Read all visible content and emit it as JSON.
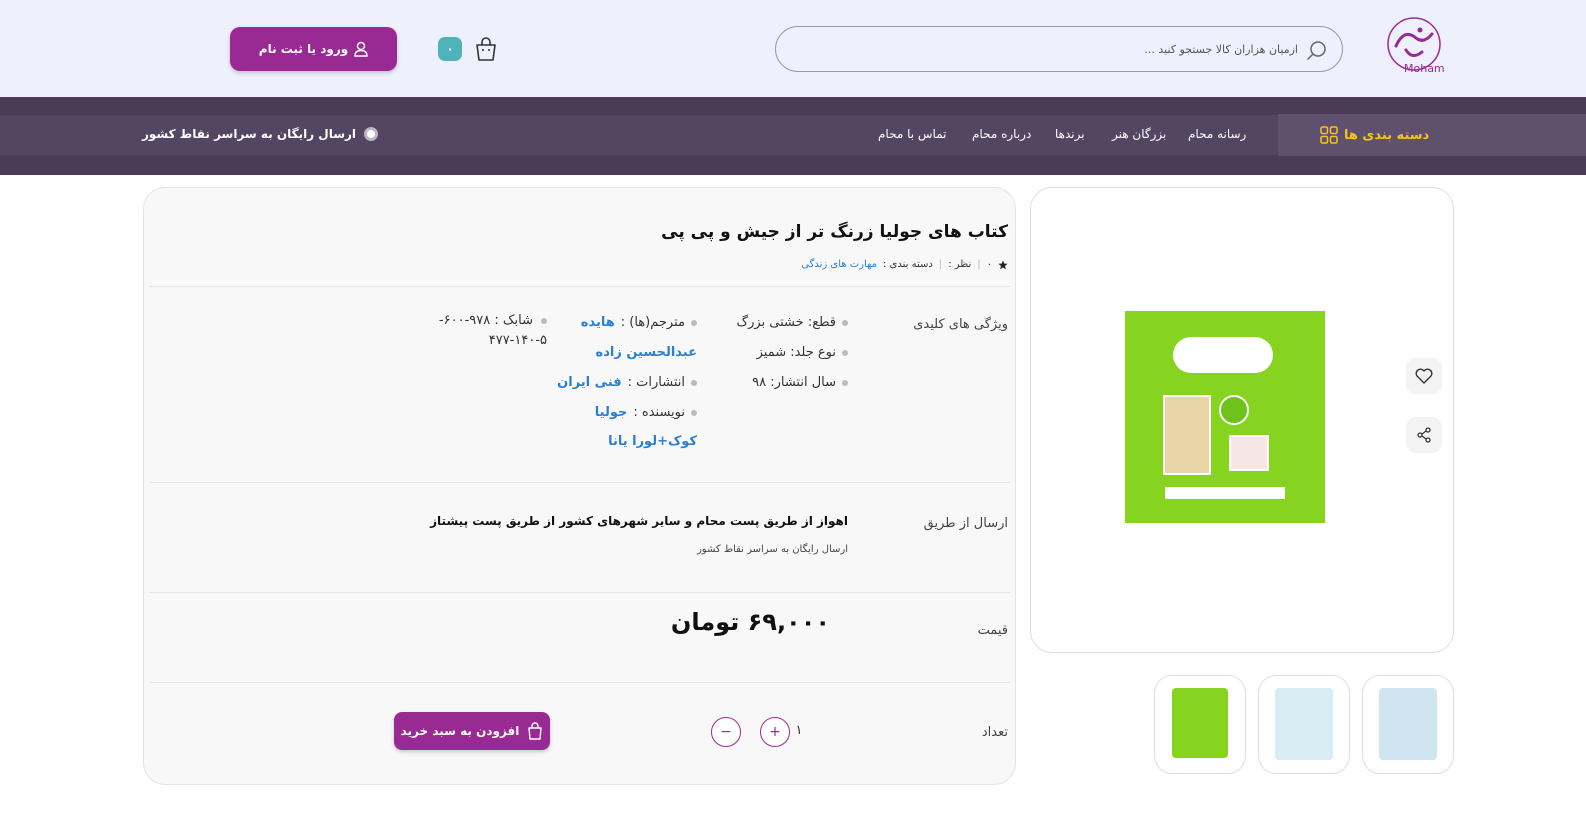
{
  "header": {
    "logo_text": "Moham",
    "search_placeholder": "ازمیان هزاران کالا جستجو کنید ...",
    "cart_count": "۰",
    "login_label": "ورود یا ثبت نام"
  },
  "nav": {
    "categories_label": "دسته بندی ها",
    "links": [
      "رسانه محام",
      "بزرگان هنر",
      "برندها",
      "درباره محام",
      "تماس با محام"
    ],
    "free_shipping": "ارسال رایگان به سراسر نقاط کشور"
  },
  "product": {
    "title": "کتاب های جولیا زرنگ تر از جیش و پی پی",
    "rating_count": "۰",
    "rating_label": "نظر :",
    "category_label": "دسته بندی :",
    "category_value": "مهارت های زندگی",
    "features_label": "ویژگی های کلیدی",
    "features": {
      "format": "قطع: خشتی بزرگ",
      "binding": "نوع جلد: شمیز",
      "year": "سال انتشار: ۹۸",
      "translator_label": "مترجم(ها) :",
      "translator_value_1": "هایده",
      "translator_value_2": "عبدالحسین زاده",
      "publisher_label": "انتشارات :",
      "publisher_value": "فنی ایران",
      "author_label": "نویسنده :",
      "author_value_1": "جولیا",
      "author_value_2": "کوک+لورا یانا",
      "isbn_label": "شابک :",
      "isbn_value_1": "۹۷۸-۶۰۰-",
      "isbn_value_2": "۴۷۷-۱۴۰-۵"
    },
    "shipping_label": "ارسال از طریق",
    "shipping_main": "اهواز از طریق پست محام و سایر شهرهای کشور از طریق پست پیشتاز",
    "shipping_sub": "ارسال رایگان به سراسر نقاط کشور",
    "price_label": "قیمت",
    "price_value": "۶۹,۰۰۰ تومان",
    "quantity_label": "تعداد",
    "quantity_value": "۱",
    "plus_label": "+",
    "minus_label": "−",
    "add_to_cart_label": "افزودن به سبد خرید"
  },
  "colors": {
    "brand": "#9a2a93",
    "nav_bg": "#4a3c57",
    "accent_yellow": "#f5c518",
    "link_blue": "#2b7fd4",
    "badge_teal": "#4fb3ba"
  }
}
